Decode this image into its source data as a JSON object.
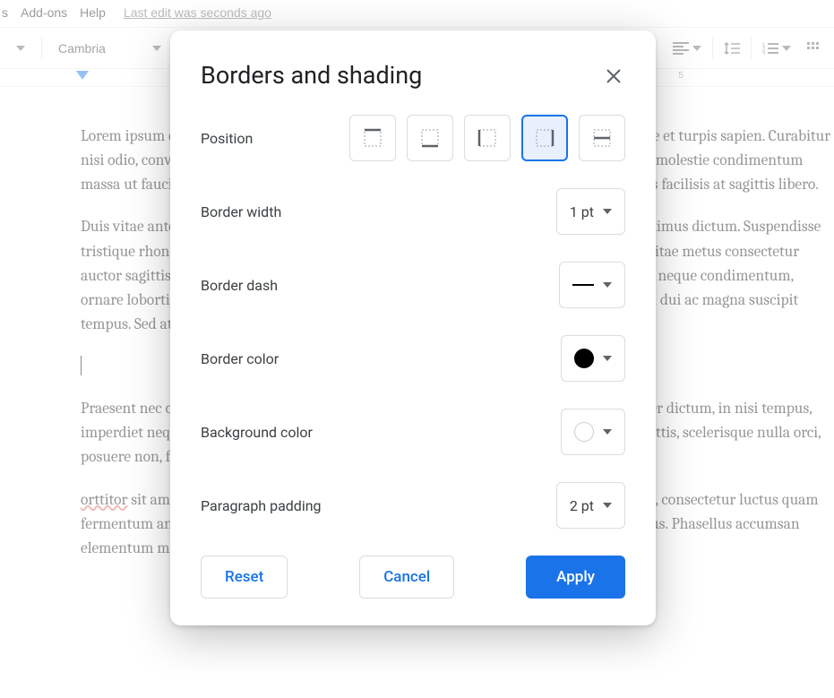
{
  "menubar": {
    "items": [
      "s",
      "Add-ons",
      "Help"
    ],
    "edit_status": "Last edit was seconds ago"
  },
  "toolbar": {
    "font_family": "Cambria",
    "ruler_number": "5"
  },
  "document": {
    "p1": "Lorem ipsum dolor sit amet, consectetur adipiscing elit. Vestibulum ac mauris. Suspendisse et turpis sapien. Curabitur nisi odio, convallis vel mi quis, efficitur varius diam, eu mollis urna ornare eget. Maecenas molestie condimentum massa ut faucibus. Vestibulum ac faucibus urna est. Sed eleifend odio egestas quam egestas facilisis at sagittis libero.",
    "p2": "Duis vitae ante suscipit, accumsan erat id, ultricies ipsum. Maecenas pellentesque nec maximus dictum. Suspendisse tristique rhoncus urna eu elementum proin praesent tempor felis. Proin venenatis lorem vitae metus consectetur auctor sagittis dui blandit. Sed ac turpis et leo fermentum. Nullam lectus ipsum, semper at neque condimentum, ornare lobortis nisi tempus elementum turpis eu ante. Pellentesque eget leo. Vestibulum in dui ac magna suscipit tempus. Sed at ante vitae.",
    "p3": "Praesent nec orci est. Phasellus mollis beatae felis ac felis tristique. Vestibulum ullamcorper dictum, in nisi tempus, imperdiet neque et, convallis ipsum. Nunc nec pulvinar facilisis erat. Quisque volutpat sagittis, scelerisque nulla orci, posuere non, feugiat felis a urna non, rutrum neque vitae lacinia tortor, quis lacinia tellus.",
    "p4": " sit amet, consectetur adipiscing elit. Nunc dignissim lorem in ipsum dolor sit amet, consectetur luctus quam fermentum ante sodales, eu mollis consequat lacus nisi. Suspendisse ne nibh suscipit cursus. Phasellus accumsan elementum malesuada.",
    "p4_misspelled": "orttitor"
  },
  "dialog": {
    "title": "Borders and shading",
    "labels": {
      "position": "Position",
      "border_width": "Border width",
      "border_dash": "Border dash",
      "border_color": "Border color",
      "background_color": "Background color",
      "paragraph_padding": "Paragraph padding"
    },
    "values": {
      "border_width": "1 pt",
      "paragraph_padding": "2 pt",
      "border_color": "#000000",
      "background_color": "#ffffff",
      "selected_position_index": 3
    },
    "buttons": {
      "reset": "Reset",
      "cancel": "Cancel",
      "apply": "Apply"
    }
  }
}
